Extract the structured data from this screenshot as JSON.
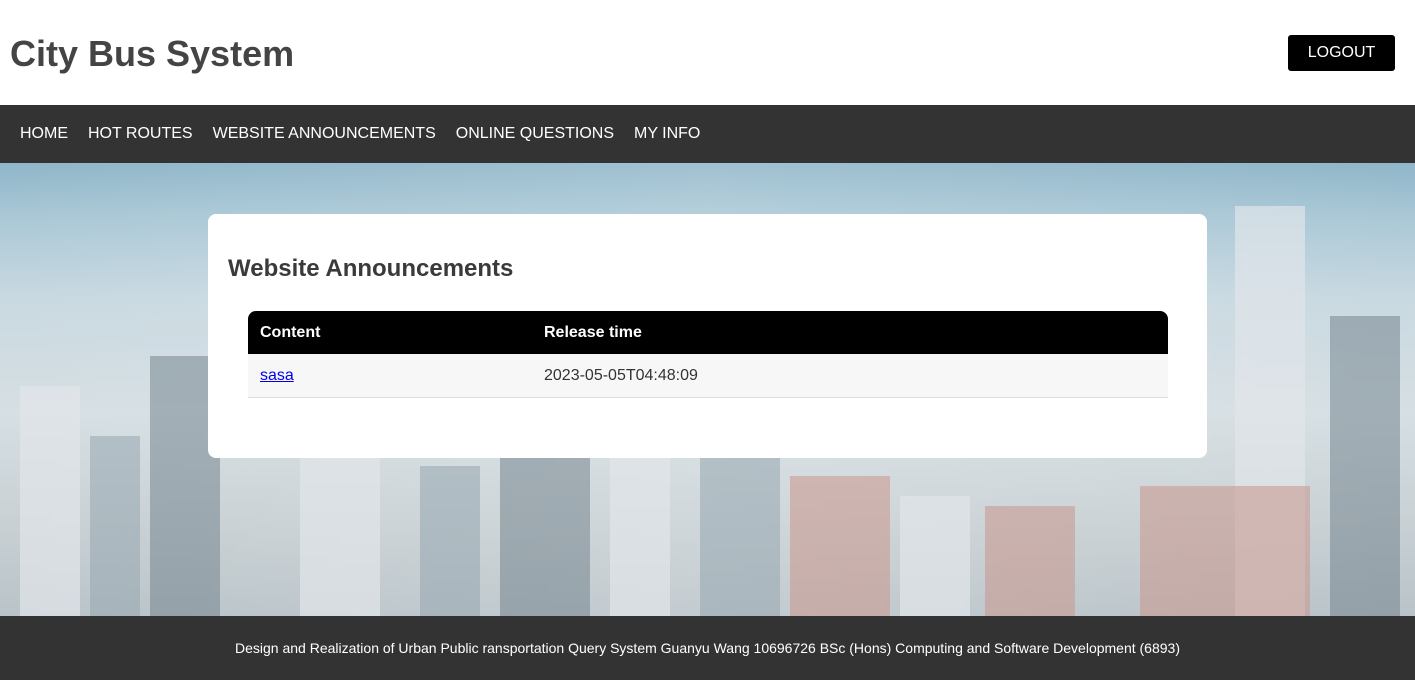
{
  "header": {
    "title": "City Bus System",
    "logout_label": "LOGOUT"
  },
  "nav": {
    "items": [
      {
        "label": "HOME"
      },
      {
        "label": "HOT ROUTES"
      },
      {
        "label": "WEBSITE ANNOUNCEMENTS"
      },
      {
        "label": "ONLINE QUESTIONS"
      },
      {
        "label": "MY INFO"
      }
    ]
  },
  "main": {
    "title": "Website Announcements",
    "table": {
      "columns": [
        "Content",
        "Release time"
      ],
      "rows": [
        {
          "content": "sasa",
          "release_time": "2023-05-05T04:48:09"
        }
      ]
    }
  },
  "footer": {
    "text": "Design and Realization of Urban Public ransportation Query System Guanyu Wang 10696726 BSc (Hons) Computing and Software Development (6893)"
  },
  "colors": {
    "nav_bg": "#333333",
    "table_header_bg": "#000000",
    "link": "#0000ee"
  }
}
